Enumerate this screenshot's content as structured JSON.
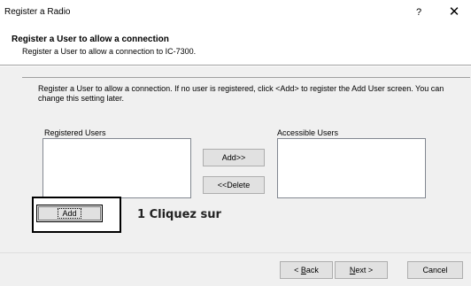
{
  "window": {
    "title": "Register a Radio",
    "help_glyph": "?",
    "close_glyph": "✕"
  },
  "header": {
    "title": "Register a User to allow a connection",
    "subtitle": "Register a User to allow a connection to IC-7300."
  },
  "main": {
    "description": "Register a User to allow a connection. If no user is registered, click <Add> to register the Add User screen. You can change this setting later.",
    "registered_users_label": "Registered Users",
    "accessible_users_label": "Accessible Users",
    "registered_users": [],
    "accessible_users": [],
    "add_transfer_label": "Add>>",
    "delete_transfer_label": "<<Delete",
    "add_button_label": "Add"
  },
  "annotation": {
    "text": "1 Cliquez sur"
  },
  "footer": {
    "back_prefix": "< ",
    "back_key": "B",
    "back_rest": "ack",
    "next_key": "N",
    "next_rest": "ext >",
    "cancel_label": "Cancel"
  }
}
